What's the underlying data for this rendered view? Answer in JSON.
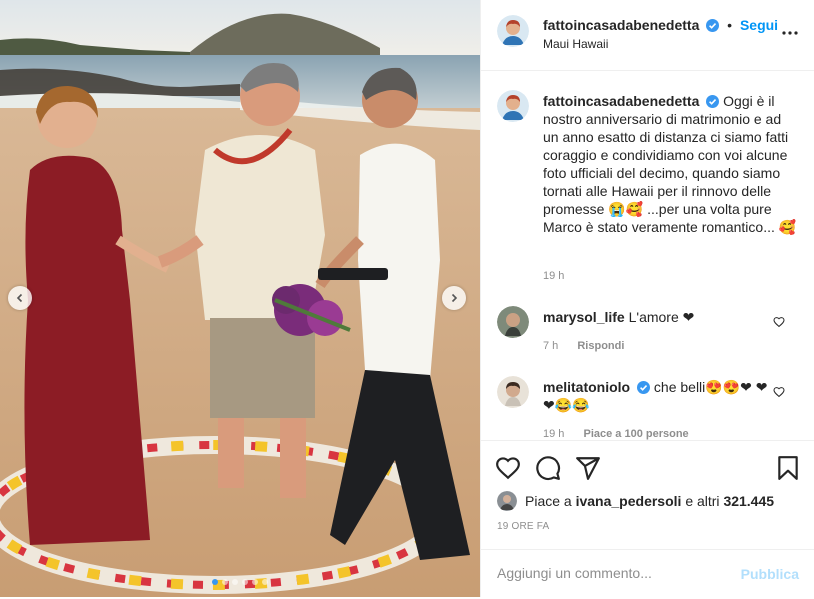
{
  "post": {
    "username": "fattoincasadabenedetta",
    "follow_label": "Segui",
    "dot": "•",
    "location": "Maui Hawaii",
    "more": "•••"
  },
  "caption": {
    "username": "fattoincasadabenedetta",
    "text": "Oggi è il nostro anniversario di matrimonio e ad un anno esatto di distanza ci siamo fatti coraggio e condividiamo con voi alcune foto ufficiali del decimo, quando siamo tornati alle Hawaii per il rinnovo delle promesse 😭🥰 ...per una volta pure Marco è stato veramente romantico... 🥰",
    "time": "19 h"
  },
  "comments": [
    {
      "username": "marysol_life",
      "text": "L'amore ❤",
      "time": "7 h",
      "reply": "Rispondi"
    },
    {
      "username": "melitatoniolo",
      "text": "che belli😍😍❤ ❤❤😂😂",
      "time": "19 h",
      "likes": "Piace a 100 persone"
    }
  ],
  "likes": {
    "prefix": "Piace a",
    "user": "ivana_pedersoli",
    "suffix": "e altri",
    "count": "321.445"
  },
  "post_time": "19 ORE FA",
  "add_comment": {
    "placeholder": "Aggiungi un commento...",
    "publish": "Pubblica"
  },
  "carousel": {
    "count": 6,
    "active_index": 0
  },
  "colors": {
    "accent": "#0095f6",
    "publish_disabled": "#b2dffc",
    "verified": "#3897f0"
  },
  "icons": [
    "chevron-left-icon",
    "chevron-right-icon",
    "verified-icon",
    "more-icon",
    "heart-icon",
    "comment-icon",
    "share-icon",
    "bookmark-icon"
  ]
}
